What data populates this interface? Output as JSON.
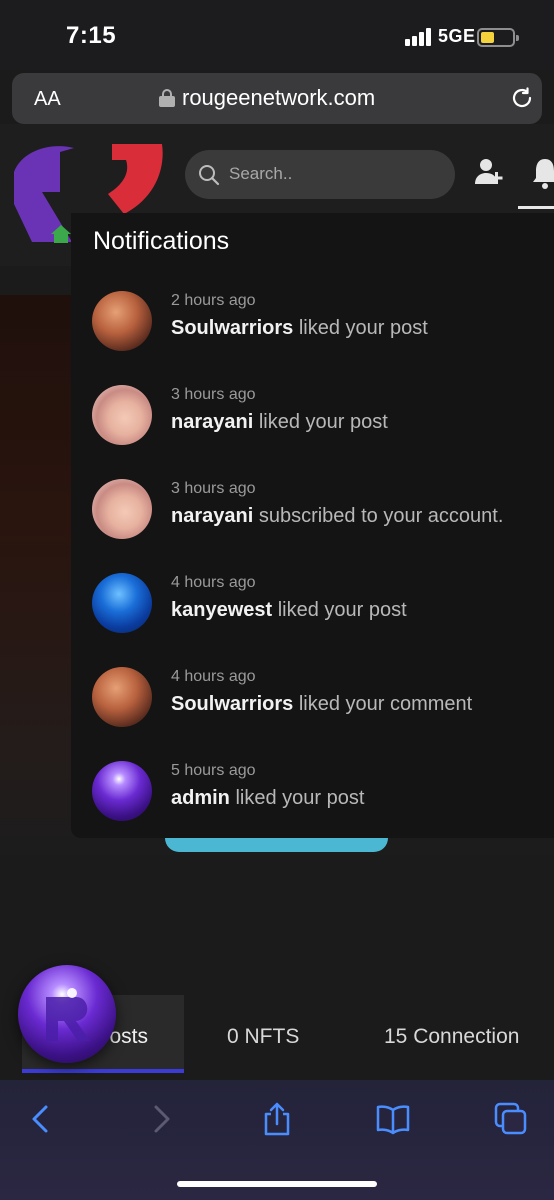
{
  "status_bar": {
    "time": "7:15",
    "network": "5GE"
  },
  "browser": {
    "text_size_label": "AA",
    "url": "rougeenetwork.com"
  },
  "header": {
    "search_placeholder": "Search.."
  },
  "notifications": {
    "title": "Notifications",
    "items": [
      {
        "time": "2 hours ago",
        "user": "Soulwarriors",
        "action": "liked your post",
        "avatar": "soulwarriors-avatar"
      },
      {
        "time": "3 hours ago",
        "user": "narayani",
        "action": "liked your post",
        "avatar": "narayani-avatar"
      },
      {
        "time": "3 hours ago",
        "user": "narayani",
        "action": "subscribed to your account.",
        "avatar": "narayani-avatar"
      },
      {
        "time": "4 hours ago",
        "user": "kanyewest",
        "action": "liked your post",
        "avatar": "kanyewest-avatar"
      },
      {
        "time": "4 hours ago",
        "user": "Soulwarriors",
        "action": "liked your comment",
        "avatar": "soulwarriors-avatar"
      },
      {
        "time": "5 hours ago",
        "user": "admin",
        "action": "liked your post",
        "avatar": "admin-avatar"
      }
    ]
  },
  "profile_tabs": {
    "posts": "osts",
    "nfts": "0 NFTS",
    "connections": "15 Connection"
  },
  "colors": {
    "accent_blue": "#4bb7d2",
    "tab_underline": "#3b3bd8",
    "logo_purple": "#6a33b5",
    "logo_red": "#d92e3a"
  }
}
